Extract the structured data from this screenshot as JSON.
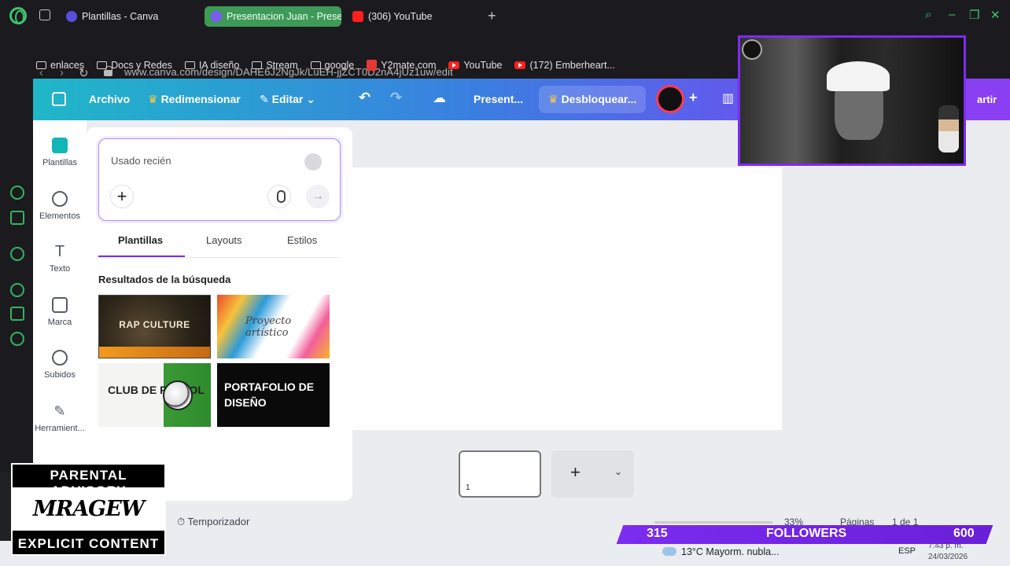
{
  "browser": {
    "tabs": [
      {
        "label": "Plantillas - Canva",
        "color": "#5b4de0"
      },
      {
        "label": "Presentacion Juan - Prese",
        "color": "#7d5cf5"
      },
      {
        "label": "(306) YouTube",
        "color": "#ff1f1f"
      }
    ],
    "url": "www.canva.com/design/DAHE6J2NgJk/LuEH-jjZCT0D2nA4jUz1uw/edit",
    "bookmarks": [
      "enlaces",
      "Docs y Redes",
      "IA diseño",
      "Stream",
      "google",
      "Y2mate.com",
      "YouTube",
      "(172) Emberheart..."
    ],
    "accent_color": "#3ec46d"
  },
  "canva": {
    "topbar": {
      "file": "Archivo",
      "resize": "Redimensionar",
      "edit": "Editar",
      "present": "Present...",
      "unlock": "Desbloquear...",
      "share_partial": "artir"
    },
    "leftnav": [
      {
        "label": "Plantillas",
        "icon": "templates-icon"
      },
      {
        "label": "Elementos",
        "icon": "elements-icon"
      },
      {
        "label": "Texto",
        "icon": "text-icon"
      },
      {
        "label": "Marca",
        "icon": "brand-icon"
      },
      {
        "label": "Subidos",
        "icon": "uploads-icon"
      },
      {
        "label": "Herramient...",
        "icon": "tools-icon"
      }
    ],
    "panel": {
      "search_placeholder": "Usado recién",
      "tabs": [
        "Plantillas",
        "Layouts",
        "Estilos"
      ],
      "results_title": "Resultados de la búsqueda",
      "templates": [
        {
          "title": "RAP CULTURE"
        },
        {
          "title": "Proyecto artístico"
        },
        {
          "title": "CLUB DE FÚTBOL"
        },
        {
          "title": "PORTAFOLIO DE DISEÑO"
        }
      ]
    },
    "page_number": "1",
    "footer": {
      "timer": "Temporizador",
      "zoom": "33%",
      "pages_label": "Páginas",
      "page_of": "1 de 1"
    }
  },
  "overlay": {
    "followers_current": "315",
    "followers_label": "FOLLOWERS",
    "followers_goal": "600",
    "parental_top": "PARENTAL ADVISORY",
    "parental_logo": "MRAGEW",
    "parental_bottom": "EXPLICIT CONTENT"
  },
  "taskbar": {
    "weather": "13°C  Mayorm. nubla...",
    "language": "ESP",
    "time": "7:43 p. m.",
    "date": "24/03/2026"
  }
}
